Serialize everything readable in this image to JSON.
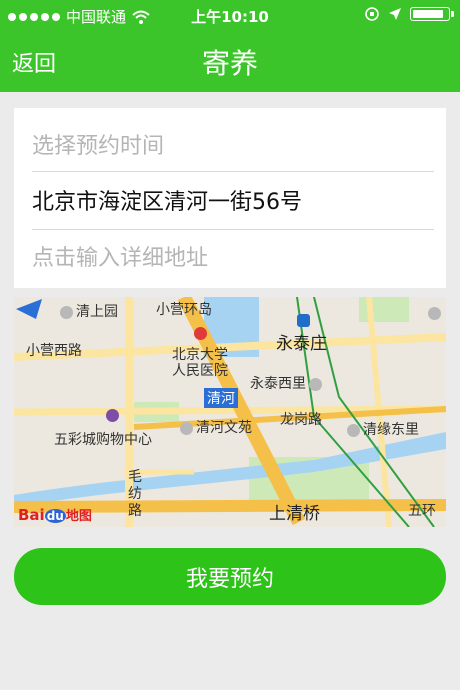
{
  "status_bar": {
    "carrier": "中国联通",
    "time": "上午10:10",
    "battery_fraction": 0.9
  },
  "nav": {
    "back_label": "返回",
    "title": "寄养"
  },
  "form": {
    "time_placeholder": "选择预约时间",
    "address": "北京市海淀区清河一街56号",
    "detail_placeholder": "点击输入详细地址"
  },
  "map": {
    "labels": {
      "qingshangyuan": "清上园",
      "xiaoyinghuandao": "小营环岛",
      "xiaoyingxilu": "小营西路",
      "beida_hospital_line1": "北京大学",
      "beida_hospital_line2": "人民医院",
      "yongtaizhuang": "永泰庄",
      "yongtaixili": "永泰西里",
      "qinghe": "清河",
      "wucaicheng": "五彩城购物中心",
      "qinghewenyuan": "清河文苑",
      "longganglu": "龙岗路",
      "qingyuandongli": "清缘东里",
      "maofanglu": "毛纺路",
      "shangqingqiao": "上清桥",
      "wuhuan": "五环"
    },
    "logo": {
      "bai": "Bai",
      "du": "du",
      "tu": "地图"
    },
    "colors": {
      "road_major": "#f5c04a",
      "road_minor": "#fbe5a0",
      "water": "#a7d3f2",
      "park": "#cde9b8",
      "rail": "#2f9f40"
    }
  },
  "submit_label": "我要预约",
  "colors": {
    "brand_green": "#3cc52a",
    "button_green": "#2dc319",
    "background": "#ebebeb"
  }
}
